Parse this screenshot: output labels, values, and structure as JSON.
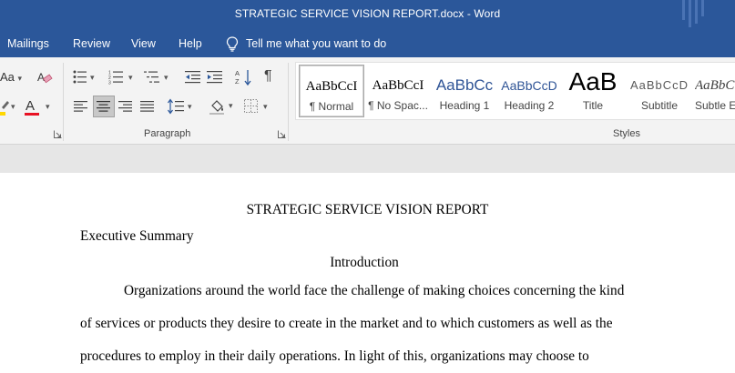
{
  "window": {
    "title": "STRATEGIC SERVICE VISION REPORT.docx  -  Word"
  },
  "menu": {
    "items": [
      "Mailings",
      "Review",
      "View",
      "Help"
    ],
    "tell_me": "Tell me what you want to do"
  },
  "ribbon": {
    "font_partial_label": "Aa",
    "paragraph_group_label": "Paragraph",
    "styles_group_label": "Styles",
    "styles": [
      {
        "sample": "AaBbCcI",
        "name": "¶ Normal",
        "selected": true
      },
      {
        "sample": "AaBbCcI",
        "name": "¶ No Spac..."
      },
      {
        "sample": "AaBbCc",
        "name": "Heading 1"
      },
      {
        "sample": "AaBbCcD",
        "name": "Heading 2"
      },
      {
        "sample": "AaB",
        "name": "Title"
      },
      {
        "sample": "AaBbCcD",
        "name": "Subtitle"
      },
      {
        "sample": "AaBbC",
        "name": "Subtle E"
      }
    ],
    "colors": {
      "accent": "#2b579a",
      "highlight": "#ffd700",
      "font_color": "#e81123",
      "heading": "#2f5496"
    }
  },
  "document": {
    "title": "STRATEGIC SERVICE VISION REPORT",
    "section": "Executive Summary",
    "subheading": "Introduction",
    "lines": [
      "Organizations around the world face the challenge of making choices concerning the kind",
      "of services or products they desire to create in the market and to which customers as well as the",
      "procedures to employ in their daily operations. In light of this, organizations may choose to"
    ]
  }
}
